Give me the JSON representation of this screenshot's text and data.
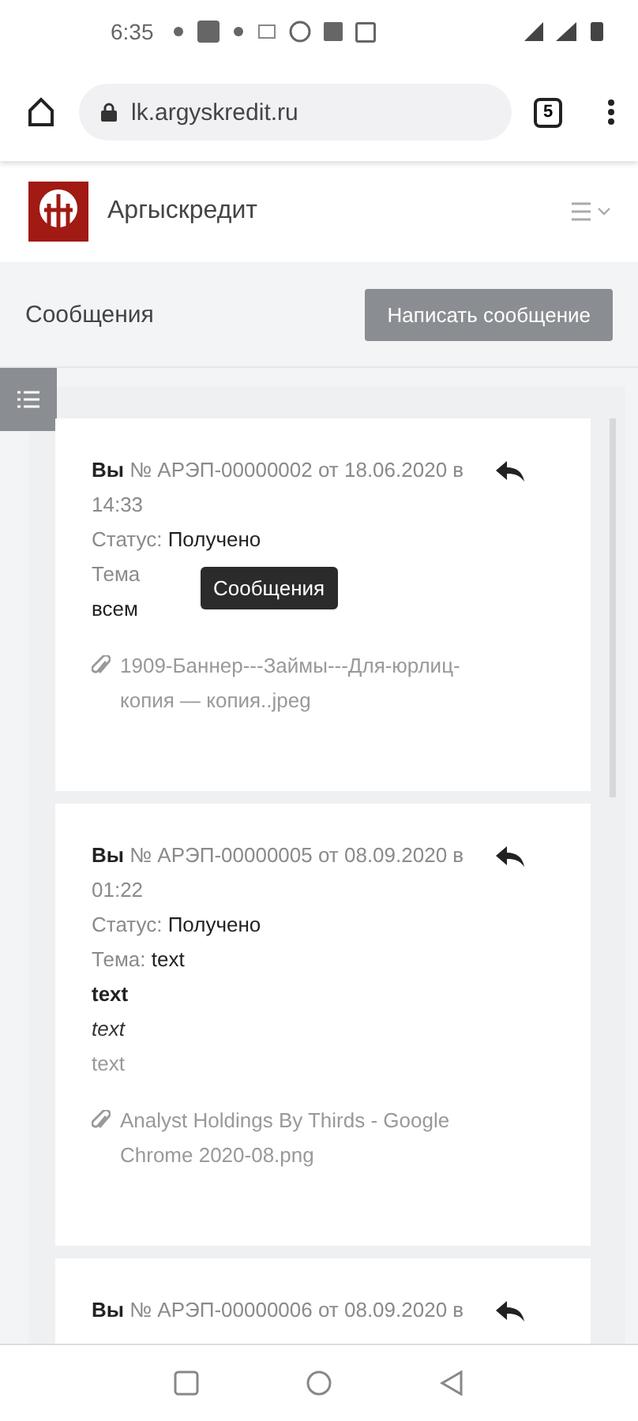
{
  "status_bar": {
    "time": "6:35"
  },
  "browser": {
    "url": "lk.argyskredit.ru",
    "tab_count": "5"
  },
  "header": {
    "brand": "Аргыскредит"
  },
  "toolbar": {
    "title": "Сообщения",
    "button": "Написать сообщение"
  },
  "tooltip": "Сообщения",
  "messages": [
    {
      "author": "Вы",
      "number": "№ АРЭП-00000002 от 18.06.2020 в",
      "time": "14:33",
      "status_label": "Статус:",
      "status": "Получено",
      "subject_label": "Тема",
      "body": [
        {
          "kind": "normal",
          "text": "всем"
        }
      ],
      "attachment": "1909-Баннер---Займы---Для-юрлиц-копия — копия..jpeg",
      "tooltip": true
    },
    {
      "author": "Вы",
      "number": "№ АРЭП-00000005 от 08.09.2020 в",
      "time": "01:22",
      "status_label": "Статус:",
      "status": "Получено",
      "subject_label": "Тема:",
      "subject": "text",
      "body": [
        {
          "kind": "bold",
          "text": "text"
        },
        {
          "kind": "italic",
          "text": "text"
        },
        {
          "kind": "muted",
          "text": "text"
        }
      ],
      "attachment": "Analyst Holdings By Thirds - Google Chrome 2020-08.png"
    },
    {
      "author": "Вы",
      "number": "№ АРЭП-00000006 от 08.09.2020 в"
    }
  ]
}
